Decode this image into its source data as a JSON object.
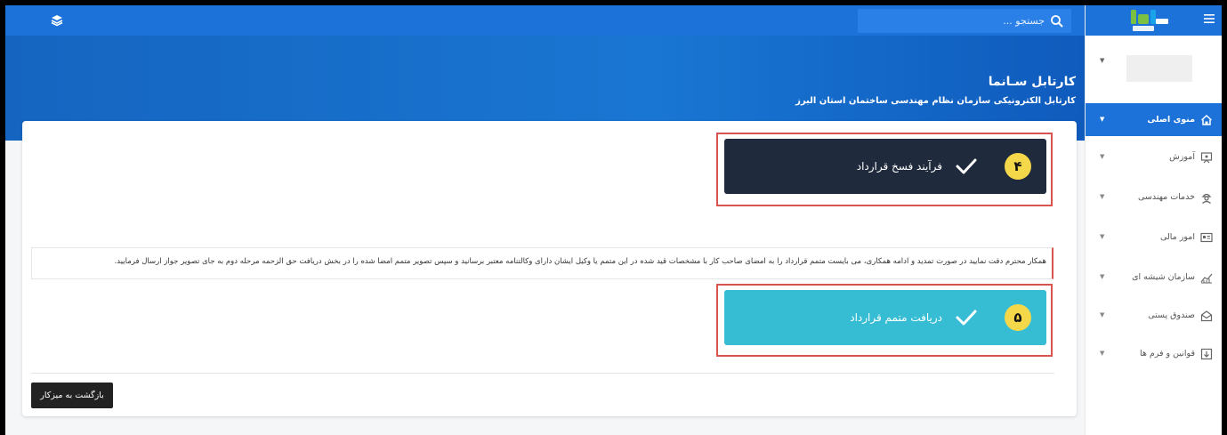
{
  "search": {
    "placeholder": "جستجو ..."
  },
  "hero": {
    "title": "کارتابل سـانما",
    "subtitle": "کارتابل الکترونیکی سازمان نظام مهندسی ساختمان استان البرز"
  },
  "steps": [
    {
      "number": "۴",
      "label": "فرآیند فسخ قرارداد",
      "color": "#1f2a3c"
    },
    {
      "number": "۵",
      "label": "دریافت متمم قرارداد",
      "color": "#36bdd4"
    }
  ],
  "notice": {
    "text": "همکار محترم دقت نمایید در صورت تمدید و ادامه همکاری، می بایست متمم قرارداد را به امضای صاحب کار با مشخصات قید شده در این متمم یا وکیل ایشان دارای وکالتنامه معتبر برسانید و سپس تصویر متمم امضا شده را در بخش دریافت حق الزحمه مرحله دوم به جای تصویر جواز ارسال فرمایید."
  },
  "back_button": {
    "label": "بازگشت به میزکار"
  },
  "sidebar": {
    "logo_caption": "سانما",
    "items": [
      {
        "label": "منوی اصلی",
        "icon": "home-icon",
        "active": true
      },
      {
        "label": "آموزش",
        "icon": "education-icon",
        "active": false
      },
      {
        "label": "خدمات مهندسی",
        "icon": "engineer-icon",
        "active": false
      },
      {
        "label": "امور مالی",
        "icon": "finance-icon",
        "active": false
      },
      {
        "label": "سازمان شیشه ای",
        "icon": "chart-icon",
        "active": false
      },
      {
        "label": "صندوق پستی",
        "icon": "mailbox-icon",
        "active": false
      },
      {
        "label": "قوانین و فرم ها",
        "icon": "download-icon",
        "active": false
      }
    ]
  },
  "colors": {
    "primary": "#1c72d9",
    "accent_yellow": "#f5d84a",
    "outline_red": "#d9534f"
  }
}
